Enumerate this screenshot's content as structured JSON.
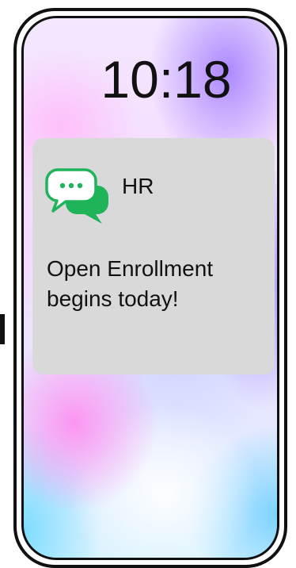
{
  "lock_screen": {
    "time": "10:18"
  },
  "notification": {
    "app_name": "HR",
    "message": "Open Enrollment begins today!",
    "icon": "chat-bubbles-icon",
    "icon_color": "#1fb35a",
    "background_color": "#d9d9d9"
  }
}
